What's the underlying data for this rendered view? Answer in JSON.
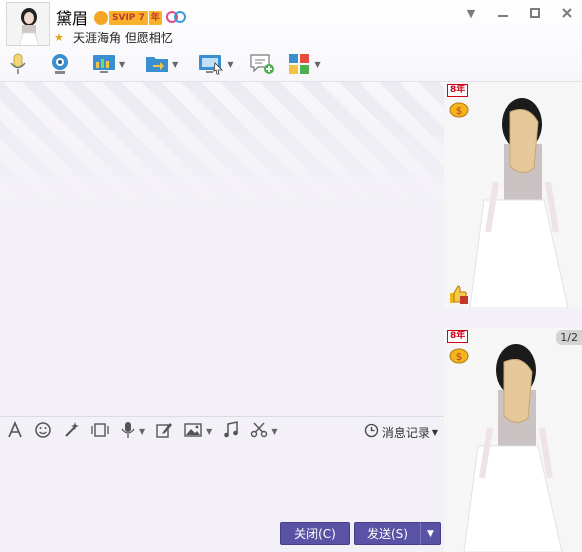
{
  "contact": {
    "name": "黛眉",
    "vip_level": "SVIP 7",
    "vip_year": "年",
    "signature": "天涯海角 但愿相忆"
  },
  "icons": {
    "voice": "microphone-icon",
    "video": "webcam-icon",
    "screen_share": "screen-share-icon",
    "file_transfer": "folder-send-icon",
    "remote_desktop": "remote-desktop-icon",
    "create_discussion": "add-chat-icon",
    "apps": "apps-grid-icon"
  },
  "input_toolbar": {
    "history_label": "消息记录"
  },
  "buttons": {
    "close": "关闭(C)",
    "send": "发送(S)"
  },
  "show_panel": {
    "page_indicator": "1/2",
    "year_tag": "8年"
  },
  "colors": {
    "button_bg": "#5a52a4",
    "vip_badge": "#f7b12a",
    "window_bg": "#f3f1f7"
  }
}
